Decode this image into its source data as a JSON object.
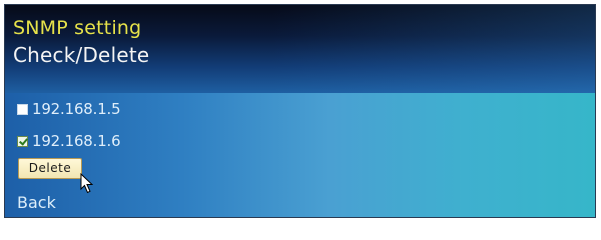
{
  "header": {
    "title": "SNMP setting",
    "subtitle": "Check/Delete"
  },
  "addresses": [
    {
      "ip": "192.168.1.5",
      "checked": false
    },
    {
      "ip": "192.168.1.6",
      "checked": true
    }
  ],
  "actions": {
    "delete_label": "Delete",
    "back_label": "Back"
  },
  "colors": {
    "title": "#e6e24a",
    "subtitle": "#f4f4f4",
    "text": "#dfeefa",
    "header_dark": "#060a18",
    "panel_left": "#1d5fa8",
    "panel_right": "#36b6c9",
    "button_face": "#f2e6b2"
  },
  "icons": {
    "pointer": "mouse-pointer-icon"
  }
}
